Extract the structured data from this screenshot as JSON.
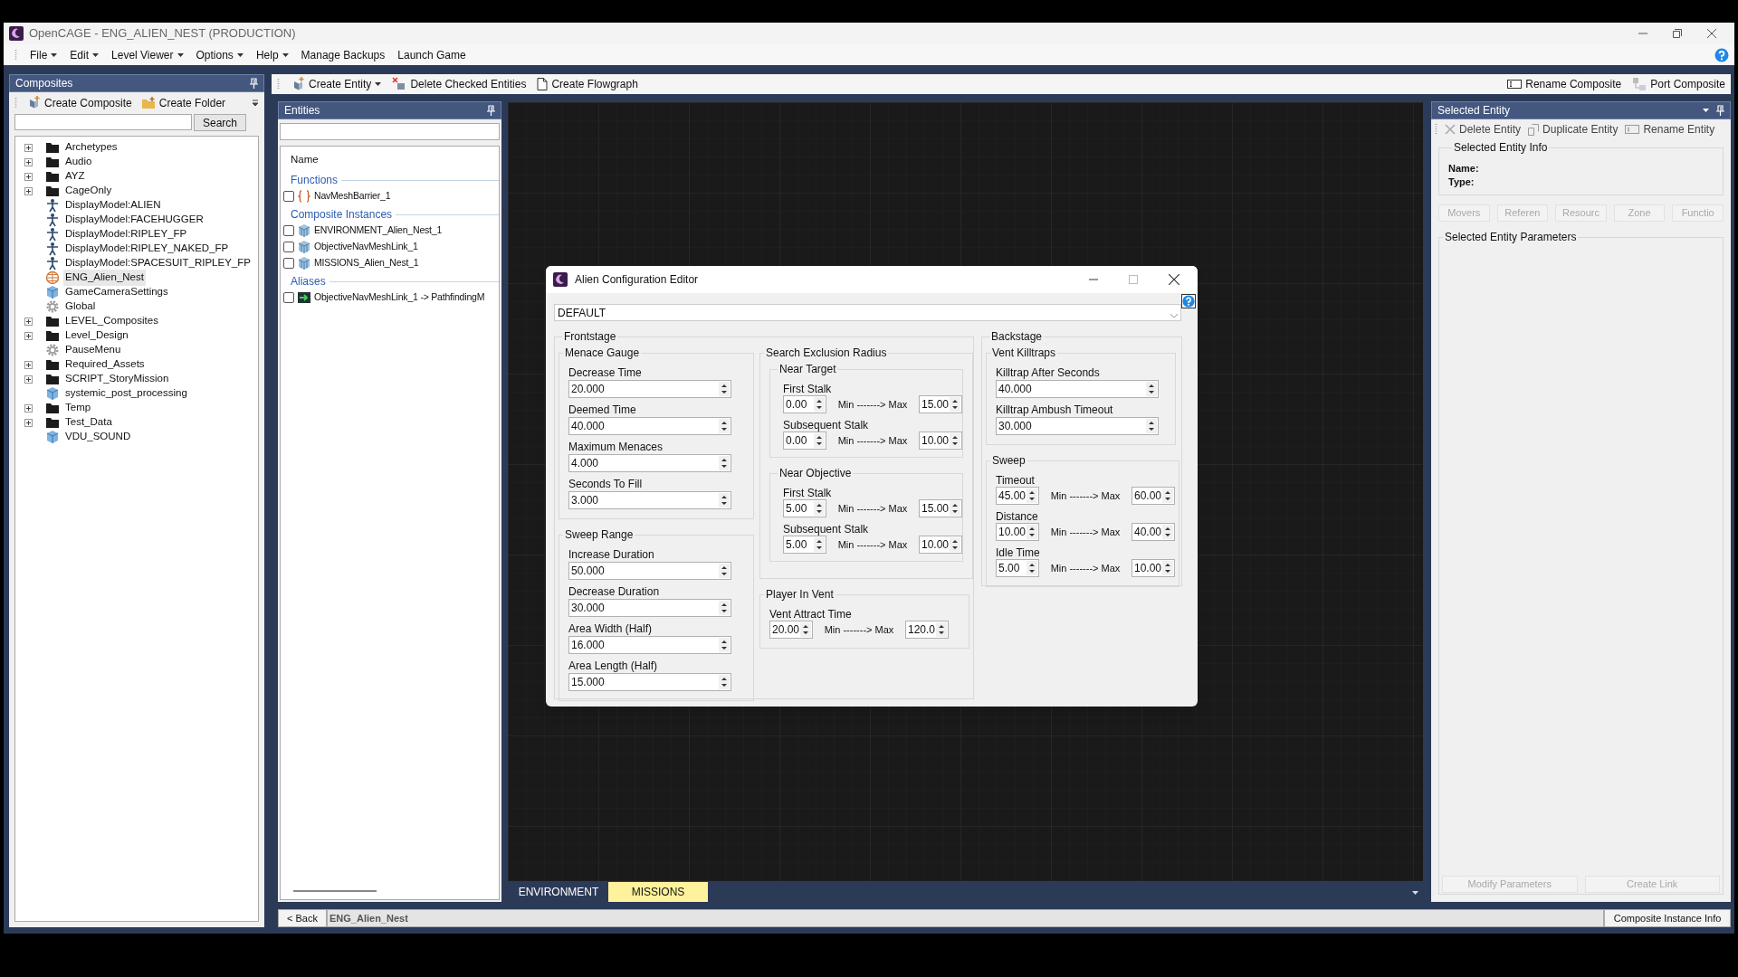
{
  "window": {
    "title": "OpenCAGE - ENG_ALIEN_NEST (PRODUCTION)"
  },
  "menu": [
    {
      "label": "File",
      "dropdown": true
    },
    {
      "label": "Edit",
      "dropdown": true
    },
    {
      "label": "Level Viewer",
      "dropdown": true
    },
    {
      "label": "Options",
      "dropdown": true
    },
    {
      "label": "Help",
      "dropdown": true
    },
    {
      "label": "Manage Backups",
      "dropdown": false
    },
    {
      "label": "Launch Game",
      "dropdown": false
    }
  ],
  "composites": {
    "title": "Composites",
    "toolbar": [
      "Create Composite",
      "Create Folder"
    ],
    "search_button": "Search",
    "tree": [
      {
        "label": "Archetypes",
        "kind": "folder",
        "selected": false
      },
      {
        "label": "Audio",
        "kind": "folder",
        "selected": false
      },
      {
        "label": "AYZ",
        "kind": "folder",
        "selected": false
      },
      {
        "label": "CageOnly",
        "kind": "folder",
        "selected": false
      },
      {
        "label": "DisplayModel:ALIEN",
        "kind": "model",
        "selected": false
      },
      {
        "label": "DisplayModel:FACEHUGGER",
        "kind": "model",
        "selected": false
      },
      {
        "label": "DisplayModel:RIPLEY_FP",
        "kind": "model",
        "selected": false
      },
      {
        "label": "DisplayModel:RIPLEY_NAKED_FP",
        "kind": "model",
        "selected": false
      },
      {
        "label": "DisplayModel:SPACESUIT_RIPLEY_FP",
        "kind": "model",
        "selected": false
      },
      {
        "label": "ENG_Alien_Nest",
        "kind": "level",
        "selected": true
      },
      {
        "label": "GameCameraSettings",
        "kind": "cube",
        "selected": false
      },
      {
        "label": "Global",
        "kind": "gear",
        "selected": false
      },
      {
        "label": "LEVEL_Composites",
        "kind": "folder",
        "selected": false
      },
      {
        "label": "Level_Design",
        "kind": "folder",
        "selected": false
      },
      {
        "label": "PauseMenu",
        "kind": "gear",
        "selected": false
      },
      {
        "label": "Required_Assets",
        "kind": "folder",
        "selected": false
      },
      {
        "label": "SCRIPT_StoryMission",
        "kind": "folder",
        "selected": false
      },
      {
        "label": "systemic_post_processing",
        "kind": "cube",
        "selected": false
      },
      {
        "label": "Temp",
        "kind": "folder",
        "selected": false
      },
      {
        "label": "Test_Data",
        "kind": "folder",
        "selected": false
      },
      {
        "label": "VDU_SOUND",
        "kind": "cube",
        "selected": false
      }
    ]
  },
  "toolbar": {
    "left": [
      {
        "label": "Create Entity",
        "dropdown": true
      },
      {
        "label": "Delete Checked Entities",
        "dropdown": false
      },
      {
        "label": "Create Flowgraph",
        "dropdown": false
      }
    ],
    "right": [
      "Rename Composite",
      "Port Composite"
    ]
  },
  "entities": {
    "title": "Entities",
    "column": "Name",
    "groups": [
      {
        "title": "Functions",
        "items": [
          {
            "label": "NavMeshBarrier_1",
            "kind": "function",
            "checked": false
          }
        ]
      },
      {
        "title": "Composite Instances",
        "items": [
          {
            "label": "ENVIRONMENT_Alien_Nest_1",
            "kind": "instance",
            "checked": false
          },
          {
            "label": "ObjectiveNavMeshLink_1",
            "kind": "instance",
            "checked": false
          },
          {
            "label": "MISSIONS_Alien_Nest_1",
            "kind": "instance",
            "checked": false
          }
        ]
      },
      {
        "title": "Aliases",
        "items": [
          {
            "label": "ObjectiveNavMeshLink_1 -> PathfindingM",
            "kind": "alias",
            "checked": false
          }
        ]
      }
    ]
  },
  "canvas": {
    "tabs": [
      {
        "label": "ENVIRONMENT",
        "selected": false
      },
      {
        "label": "MISSIONS",
        "selected": true
      }
    ]
  },
  "dialog": {
    "title": "Alien Configuration Editor",
    "preset": "DEFAULT",
    "sections": [
      {
        "title": "Frontstage",
        "columns": [
          [
            {
              "title": "Menace Gauge",
              "items": [
                {
                  "kind": "number",
                  "label": "Decrease Time",
                  "value": "20.000"
                },
                {
                  "kind": "number",
                  "label": "Deemed Time",
                  "value": "40.000"
                },
                {
                  "kind": "number",
                  "label": "Maximum Menaces",
                  "value": "4.000"
                },
                {
                  "kind": "number",
                  "label": "Seconds To Fill",
                  "value": "3.000"
                }
              ]
            },
            {
              "title": "Sweep Range",
              "items": [
                {
                  "kind": "number",
                  "label": "Increase Duration",
                  "value": "50.000"
                },
                {
                  "kind": "number",
                  "label": "Decrease Duration",
                  "value": "30.000"
                },
                {
                  "kind": "number",
                  "label": "Area Width (Half)",
                  "value": "16.000"
                },
                {
                  "kind": "number",
                  "label": "Area Length (Half)",
                  "value": "15.000"
                }
              ]
            }
          ],
          [
            {
              "title": "Search Exclusion Radius",
              "items": [
                {
                  "kind": "group",
                  "title": "Near Target",
                  "items": [
                    {
                      "kind": "range",
                      "label": "First Stalk",
                      "min": "0.00",
                      "separator": "Min -------> Max",
                      "max": "15.00"
                    },
                    {
                      "kind": "range",
                      "label": "Subsequent Stalk",
                      "min": "0.00",
                      "separator": "Min -------> Max",
                      "max": "10.00"
                    }
                  ]
                },
                {
                  "kind": "group",
                  "title": "Near Objective",
                  "items": [
                    {
                      "kind": "range",
                      "label": "First Stalk",
                      "min": "5.00",
                      "separator": "Min -------> Max",
                      "max": "15.00"
                    },
                    {
                      "kind": "range",
                      "label": "Subsequent Stalk",
                      "min": "5.00",
                      "separator": "Min -------> Max",
                      "max": "10.00"
                    }
                  ]
                }
              ]
            },
            {
              "title": "Player In Vent",
              "items": [
                {
                  "kind": "range",
                  "label": "Vent Attract Time",
                  "min": "20.00",
                  "separator": "Min -------> Max",
                  "max": "120.0"
                }
              ]
            }
          ]
        ]
      },
      {
        "title": "Backstage",
        "columns": [
          [
            {
              "title": "Vent Killtraps",
              "items": [
                {
                  "kind": "number",
                  "label": "Killtrap After Seconds",
                  "value": "40.000"
                },
                {
                  "kind": "number",
                  "label": "Killtrap Ambush Timeout",
                  "value": "30.000"
                }
              ]
            },
            {
              "title": "Sweep",
              "items": [
                {
                  "kind": "range",
                  "label": "Timeout",
                  "min": "45.00",
                  "separator": "Min -------> Max",
                  "max": "60.00"
                },
                {
                  "kind": "range",
                  "label": "Distance",
                  "min": "10.00",
                  "separator": "Min -------> Max",
                  "max": "40.00"
                },
                {
                  "kind": "range",
                  "label": "Idle Time",
                  "min": "5.00",
                  "separator": "Min -------> Max",
                  "max": "10.00"
                }
              ]
            }
          ]
        ]
      }
    ]
  },
  "selected_entity": {
    "title": "Selected Entity",
    "toolbar": [
      "Delete Entity",
      "Duplicate Entity",
      "Rename Entity"
    ],
    "info_title": "Selected Entity Info",
    "info_fields": [
      "Name:",
      "Type:"
    ],
    "tabs": [
      {
        "label": "Movers",
        "disabled": true
      },
      {
        "label": "Referen",
        "disabled": true
      },
      {
        "label": "Resourc",
        "disabled": true
      },
      {
        "label": "Zone",
        "disabled": true
      },
      {
        "label": "Functio",
        "disabled": true
      }
    ],
    "params_title": "Selected Entity Parameters",
    "buttons": [
      {
        "label": "Modify Parameters",
        "disabled": true
      },
      {
        "label": "Create Link",
        "disabled": true
      }
    ]
  },
  "status_bar": {
    "back": "< Back",
    "path": "ENG_Alien_Nest",
    "info": "Composite Instance Info"
  }
}
